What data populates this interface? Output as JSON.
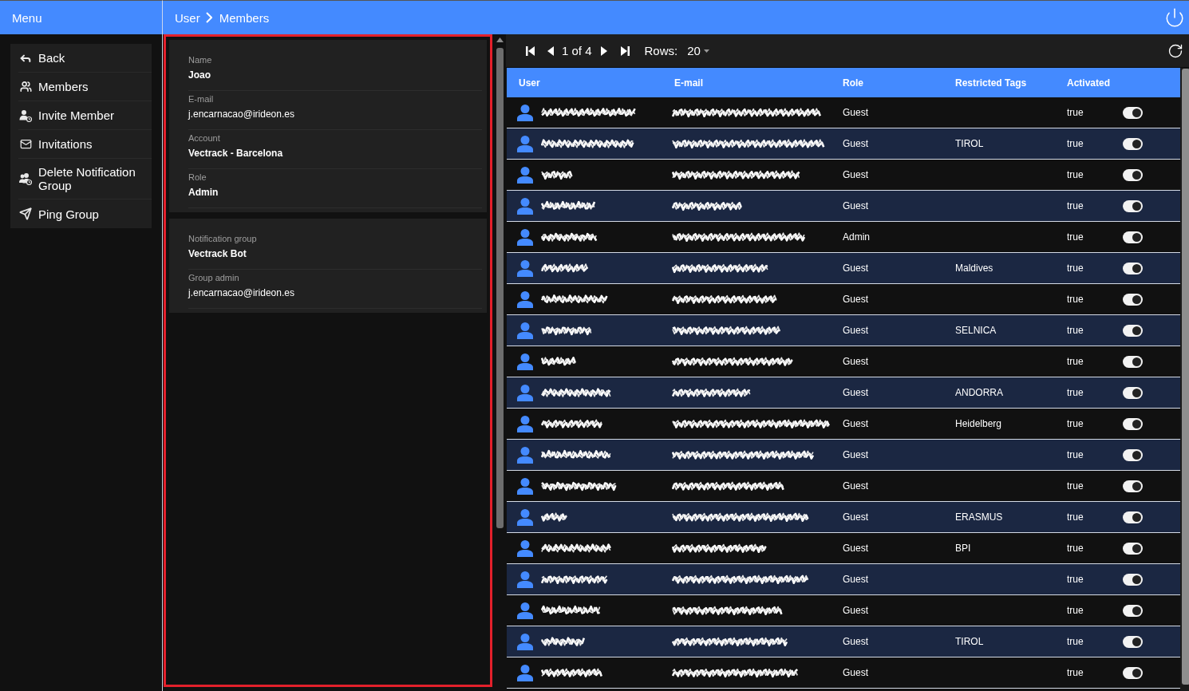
{
  "header": {
    "menu_title": "Menu",
    "breadcrumb": [
      "User",
      "Members"
    ]
  },
  "sidebar": {
    "items": [
      {
        "label": "Back"
      },
      {
        "label": "Members"
      },
      {
        "label": "Invite Member"
      },
      {
        "label": "Invitations"
      },
      {
        "label": "Delete Notification Group"
      },
      {
        "label": "Ping Group"
      }
    ]
  },
  "details": {
    "highlighted": true,
    "cards": [
      {
        "fields": [
          {
            "label": "Name",
            "value": "Joao",
            "kind": "text"
          },
          {
            "label": "E-mail",
            "value": "j.encarnacao@irideon.es",
            "kind": "email"
          },
          {
            "label": "Account",
            "value": "Vectrack - Barcelona",
            "kind": "text"
          },
          {
            "label": "Role",
            "value": "Admin",
            "kind": "text"
          }
        ]
      },
      {
        "fields": [
          {
            "label": "Notification group",
            "value": "Vectrack Bot",
            "kind": "text"
          },
          {
            "label": "Group admin",
            "value": "j.encarnacao@irideon.es",
            "kind": "email"
          }
        ]
      }
    ]
  },
  "pager": {
    "page": "1 of 4",
    "rows_label": "Rows:",
    "rows_value": "20"
  },
  "table": {
    "columns": [
      "User",
      "E-mail",
      "Role",
      "Restricted Tags",
      "Activated"
    ],
    "rows": [
      {
        "role": "Guest",
        "activated": "true",
        "enabled": true
      },
      {
        "role": "Guest",
        "restricted_tags": "TIROL",
        "activated": "true",
        "enabled": true
      },
      {
        "role": "Guest",
        "activated": "true",
        "enabled": true
      },
      {
        "role": "Guest",
        "activated": "true",
        "enabled": true
      },
      {
        "role": "Admin",
        "activated": "true",
        "enabled": true
      },
      {
        "role": "Guest",
        "restricted_tags": "Maldives",
        "activated": "true",
        "enabled": true
      },
      {
        "role": "Guest",
        "activated": "true",
        "enabled": true
      },
      {
        "role": "Guest",
        "restricted_tags": "SELNICA",
        "activated": "true",
        "enabled": true
      },
      {
        "role": "Guest",
        "activated": "true",
        "enabled": true
      },
      {
        "role": "Guest",
        "restricted_tags": "ANDORRA",
        "activated": "true",
        "enabled": true
      },
      {
        "role": "Guest",
        "restricted_tags": "Heidelberg",
        "activated": "true",
        "enabled": true
      },
      {
        "role": "Guest",
        "activated": "true",
        "enabled": true
      },
      {
        "role": "Guest",
        "activated": "true",
        "enabled": true
      },
      {
        "role": "Guest",
        "restricted_tags": "ERASMUS",
        "activated": "true",
        "enabled": true
      },
      {
        "role": "Guest",
        "restricted_tags": "BPI",
        "activated": "true",
        "enabled": true
      },
      {
        "role": "Guest",
        "activated": "true",
        "enabled": true
      },
      {
        "role": "Guest",
        "activated": "true",
        "enabled": true
      },
      {
        "role": "Guest",
        "restricted_tags": "TIROL",
        "activated": "true",
        "enabled": true
      },
      {
        "role": "Guest",
        "activated": "true",
        "enabled": true
      }
    ]
  }
}
